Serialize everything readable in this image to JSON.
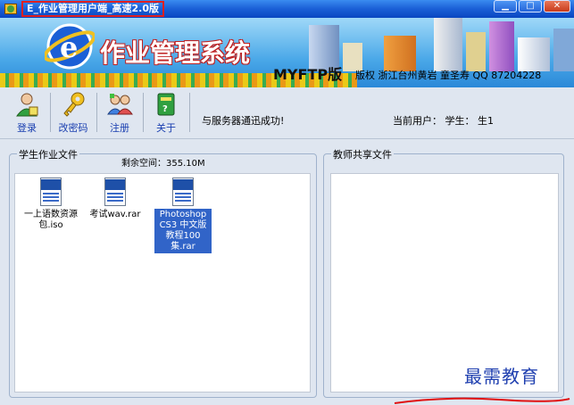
{
  "window": {
    "title": "E_作业管理用户端_高速2.0版",
    "minimize_glyph": "▁",
    "maximize_glyph": "□",
    "close_glyph": "✕"
  },
  "banner": {
    "app_name": "作业管理系统",
    "version_label": "MYFTP版",
    "copyright": "版权 浙江台州黄岩 童圣寿 QQ 87204228"
  },
  "toolbar": {
    "buttons": [
      {
        "label": "登录",
        "icon": "login-user-icon"
      },
      {
        "label": "改密码",
        "icon": "key-icon"
      },
      {
        "label": "注册",
        "icon": "register-users-icon"
      },
      {
        "label": "关于",
        "icon": "book-icon"
      }
    ],
    "status_message": "与服务器通迅成功!",
    "current_user": "当前用户： 学生： 生1"
  },
  "student_panel": {
    "title": "学生作业文件",
    "remaining_space": "剩余空间：355.10M",
    "files": [
      {
        "name": "一上语数资源包.iso",
        "selected": false
      },
      {
        "name": "考试wav.rar",
        "selected": false
      },
      {
        "name": "Photoshop CS3 中文版教程100集.rar",
        "selected": true
      }
    ]
  },
  "teacher_panel": {
    "title": "教师共享文件"
  },
  "watermark": "最需教育",
  "colors": {
    "titlebar": "#1a5fd6",
    "selection": "#3164c8",
    "toolbar_bg": "#dfe6f0",
    "label_blue": "#1a3fb0"
  }
}
